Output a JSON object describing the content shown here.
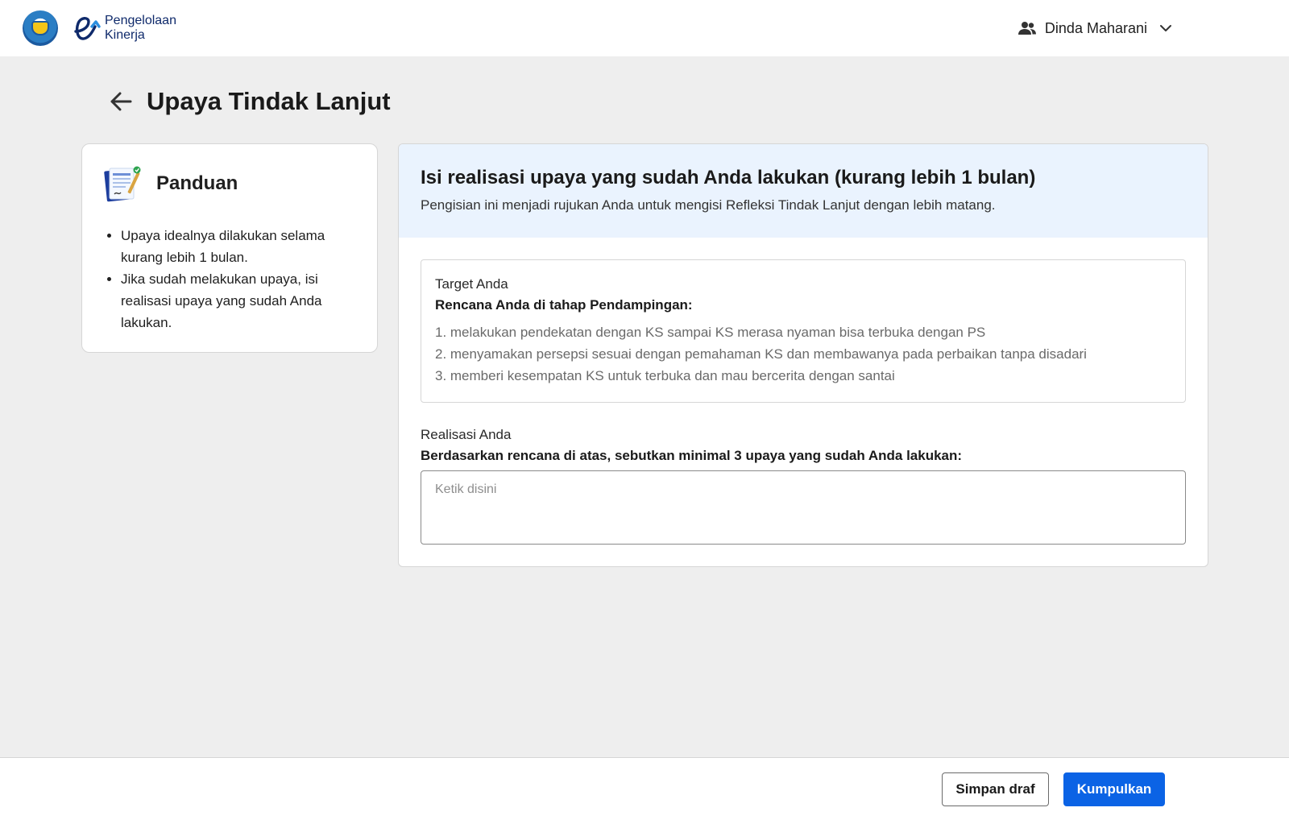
{
  "header": {
    "brand_line1": "Pengelolaan",
    "brand_line2": "Kinerja",
    "user_name": "Dinda Maharani",
    "user_icon": "people-icon",
    "dropdown_icon": "chevron-down-icon"
  },
  "page": {
    "title": "Upaya Tindak Lanjut",
    "back_icon": "arrow-left-icon"
  },
  "guide": {
    "title": "Panduan",
    "icon": "document-checklist-icon",
    "items": [
      "Upaya idealnya dilakukan selama kurang lebih 1 bulan.",
      "Jika sudah melakukan upaya, isi realisasi upaya yang sudah Anda lakukan."
    ]
  },
  "main": {
    "title": "Isi realisasi upaya yang sudah Anda lakukan (kurang lebih 1 bulan)",
    "subtitle": "Pengisian ini menjadi rujukan Anda untuk mengisi Refleksi Tindak Lanjut dengan lebih matang.",
    "target": {
      "label": "Target Anda",
      "heading": "Rencana Anda di tahap Pendampingan:",
      "plans": [
        "1. melakukan pendekatan dengan KS sampai KS merasa nyaman bisa terbuka dengan PS",
        "2. menyamakan persepsi sesuai dengan pemahaman KS dan membawanya pada perbaikan tanpa disadari",
        "3. memberi kesempatan KS untuk terbuka dan mau bercerita dengan santai"
      ]
    },
    "realisasi": {
      "label": "Realisasi Anda",
      "heading": "Berdasarkan rencana di atas, sebutkan minimal 3 upaya yang sudah Anda lakukan:",
      "value": "",
      "placeholder": "Ketik disini"
    }
  },
  "footer": {
    "draft_label": "Simpan draf",
    "submit_label": "Kumpulkan"
  },
  "colors": {
    "primary": "#0b63e5",
    "banner_bg": "#eaf3fe",
    "page_bg": "#eeeeee",
    "brand_navy": "#0f2a6b"
  }
}
